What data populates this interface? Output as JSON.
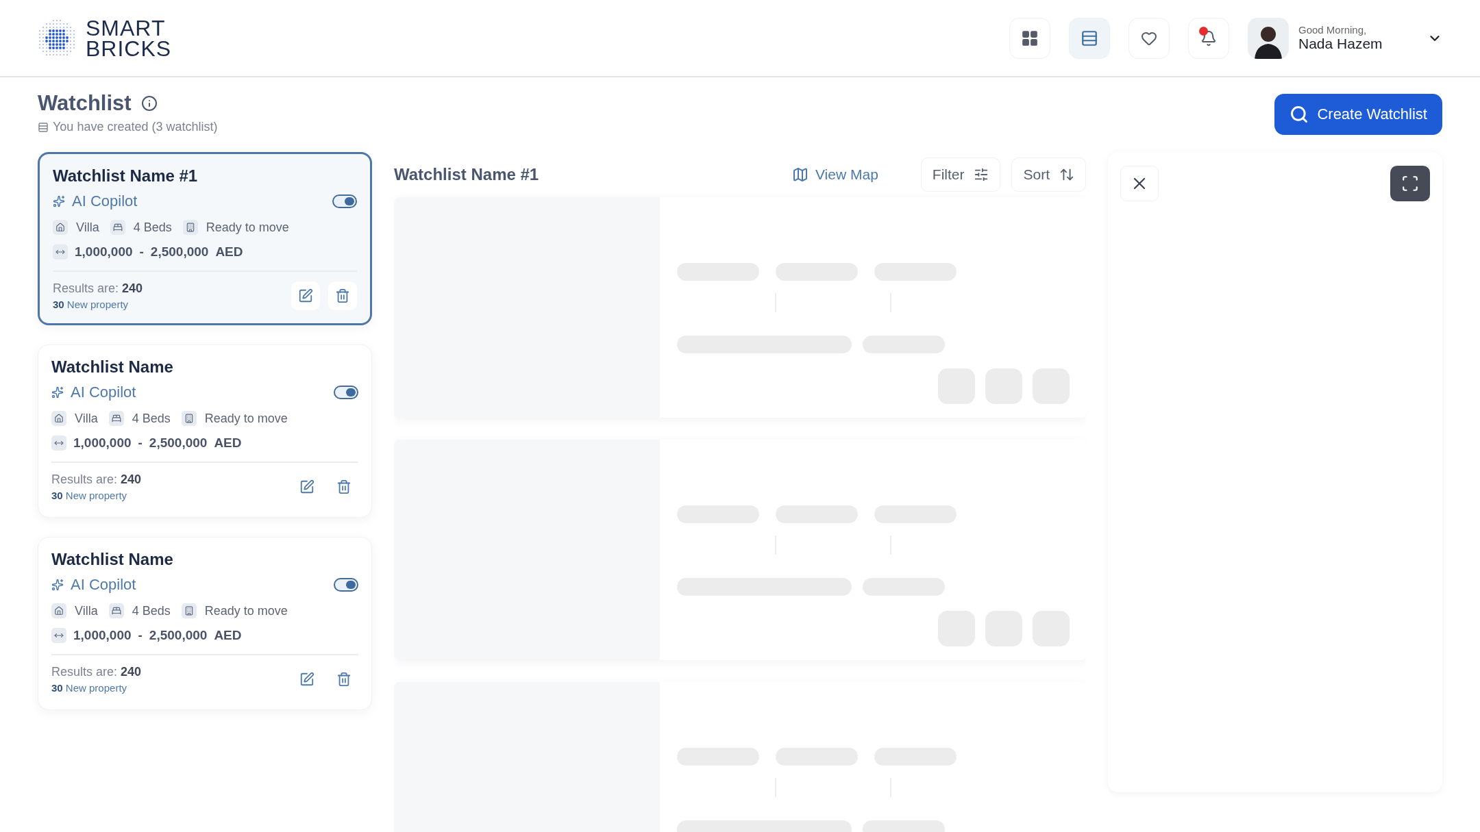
{
  "header": {
    "logo_lines": [
      "SMART",
      "BRICKS"
    ],
    "nav_buttons": [
      {
        "kind": "grid",
        "selected": false
      },
      {
        "kind": "list",
        "selected": true
      },
      {
        "kind": "heart",
        "selected": false
      },
      {
        "kind": "bell",
        "selected": false,
        "unread": true
      }
    ],
    "user": {
      "greeting": "Good Morning,",
      "name": "Nada Hazem"
    }
  },
  "page": {
    "title": "Watchlist",
    "subtitle": "You have created (3 watchlist)",
    "create_button": "Create Watchlist"
  },
  "watchlists": [
    {
      "name": "Watchlist Name #1",
      "selected": true,
      "copilot_label": "AI Copilot",
      "copilot_on": true,
      "type": "Villa",
      "beds": "4 Beds",
      "status": "Ready to move",
      "price_min": "1,000,000",
      "price_sep": "-",
      "price_max": "2,500,000",
      "currency": "AED",
      "results": "Results are: **240**",
      "new_properties": "**30** New property"
    },
    {
      "name": "Watchlist Name",
      "selected": false,
      "copilot_label": "AI Copilot",
      "copilot_on": true,
      "type": "Villa",
      "beds": "4 Beds",
      "status": "Ready to move",
      "price_min": "1,000,000",
      "price_sep": "-",
      "price_max": "2,500,000",
      "currency": "AED",
      "results": "Results are: **240**",
      "new_properties": "**30** New property"
    },
    {
      "name": "Watchlist Name",
      "selected": false,
      "copilot_label": "AI Copilot",
      "copilot_on": true,
      "type": "Villa",
      "beds": "4 Beds",
      "status": "Ready to move",
      "price_min": "1,000,000",
      "price_sep": "-",
      "price_max": "2,500,000",
      "currency": "AED",
      "results": "Results are: **240**",
      "new_properties": "**30** New property"
    }
  ],
  "results_panel": {
    "title": "Watchlist Name #1",
    "view_map": "View Map",
    "filter": "Filter",
    "sort": "Sort"
  }
}
